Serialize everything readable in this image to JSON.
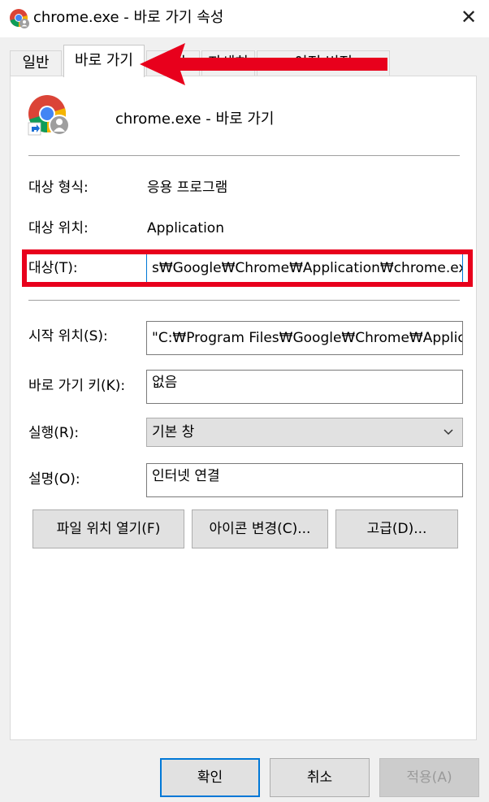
{
  "window": {
    "title": "chrome.exe - 바로 가기 속성",
    "close_glyph": "✕"
  },
  "tabs": [
    {
      "label": "일반"
    },
    {
      "label": "바로 가기"
    },
    {
      "label": "보안"
    },
    {
      "label": "자세히"
    },
    {
      "label": "이전 버전"
    }
  ],
  "shortcut": {
    "name": "chrome.exe - 바로 가기"
  },
  "fields": {
    "target_type_label": "대상 형식:",
    "target_type_value": "응용 프로그램",
    "target_location_label": "대상 위치:",
    "target_location_value": "Application",
    "target_label": "대상(T):",
    "target_value": "s₩Google₩Chrome₩Application₩chrome.exe\"",
    "start_in_label": "시작 위치(S):",
    "start_in_value": "\"C:₩Program Files₩Google₩Chrome₩Applicati",
    "shortcut_key_label": "바로 가기 키(K):",
    "shortcut_key_value": "없음",
    "run_label": "실행(R):",
    "run_value": "기본 창",
    "comment_label": "설명(O):",
    "comment_value": "인터넷 연결"
  },
  "buttons": {
    "open_location": "파일 위치 열기(F)",
    "change_icon": "아이콘 변경(C)...",
    "advanced": "고급(D)...",
    "ok": "확인",
    "cancel": "취소",
    "apply": "적용(A)"
  },
  "colors": {
    "annotation_red": "#e8001c",
    "focus_blue": "#0078d7"
  }
}
